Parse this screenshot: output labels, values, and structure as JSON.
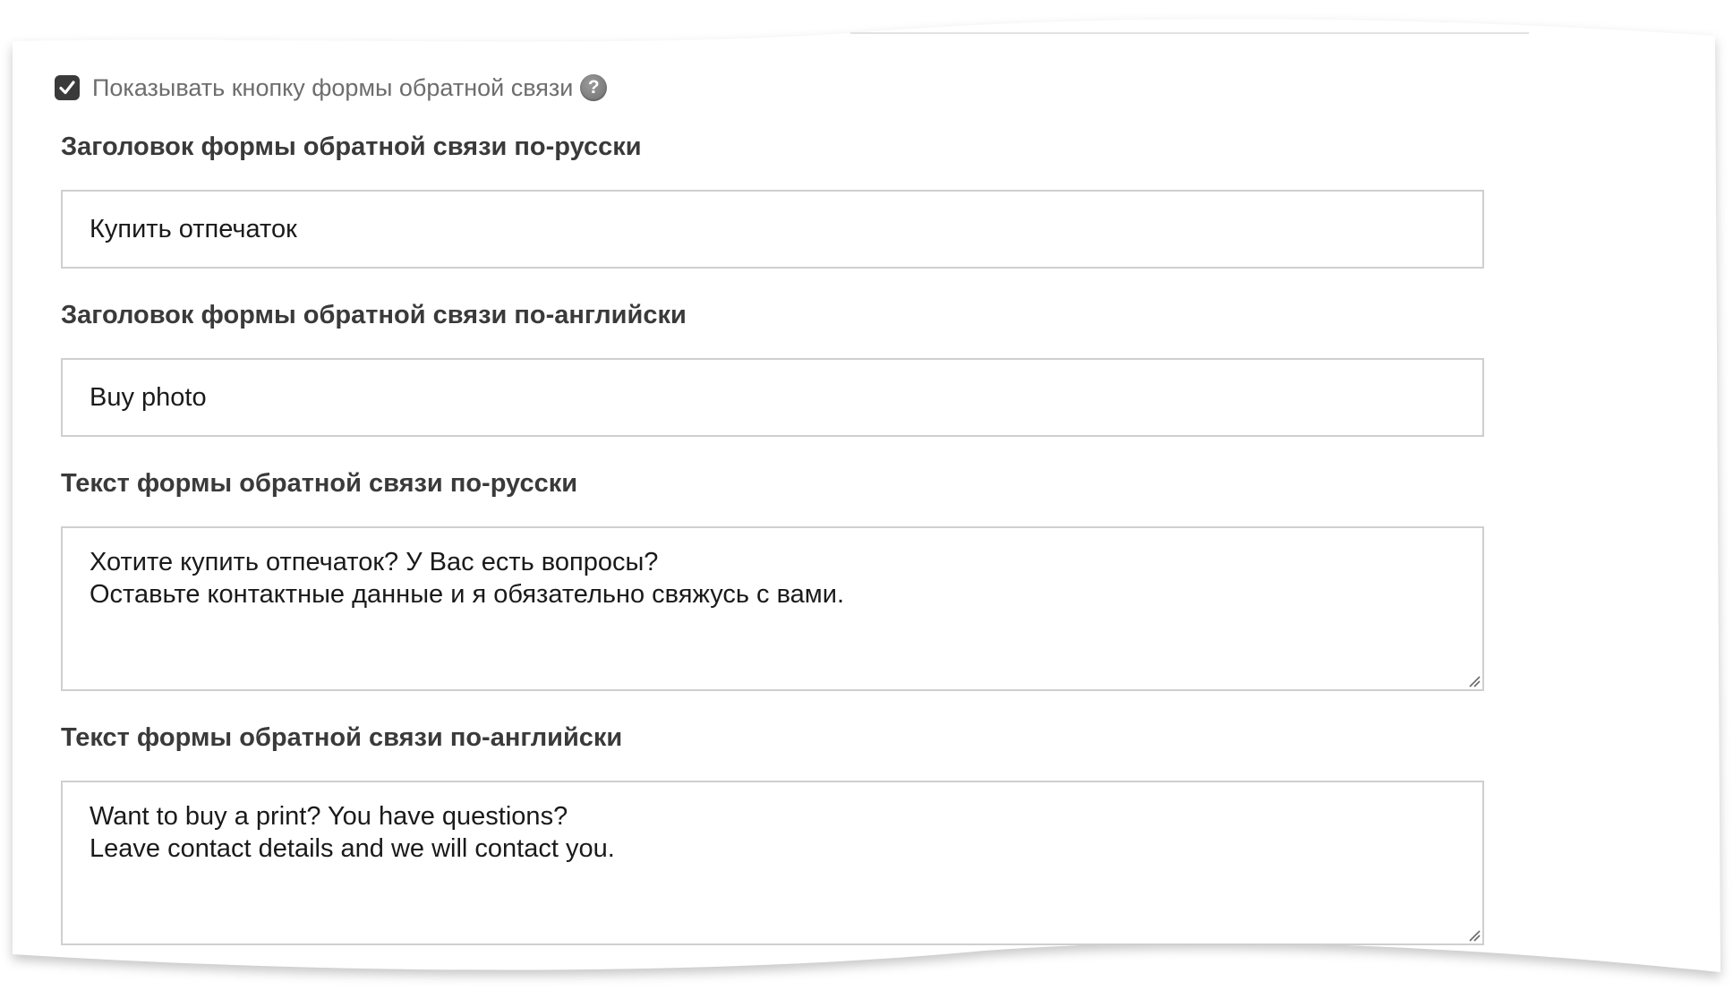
{
  "show_feedback_button": {
    "checked": true,
    "label": "Показывать кнопку формы обратной связи",
    "help_glyph": "?",
    "help_icon": "question-circle-icon"
  },
  "fields": [
    {
      "label": "Заголовок формы обратной связи по-русски",
      "type": "input",
      "value": "Купить отпечаток"
    },
    {
      "label": "Заголовок формы обратной связи по-английски",
      "type": "input",
      "value": "Buy photo"
    },
    {
      "label": "Текст формы обратной связи по-русски",
      "type": "textarea",
      "lines": [
        "Хотите купить отпечаток? У Вас есть вопросы?",
        "Оставьте контактные данные и я обязательно свяжусь с вами."
      ]
    },
    {
      "label": "Текст формы обратной связи по-английски",
      "type": "textarea",
      "lines": [
        "Want to buy a print? You have questions?",
        "Leave contact details and we will contact you."
      ]
    }
  ],
  "colors": {
    "checkbox_fill": "#3a3a3a",
    "label_text": "#3a3a3a",
    "muted_text": "#6d6d6d",
    "border": "#cfcfcf"
  }
}
